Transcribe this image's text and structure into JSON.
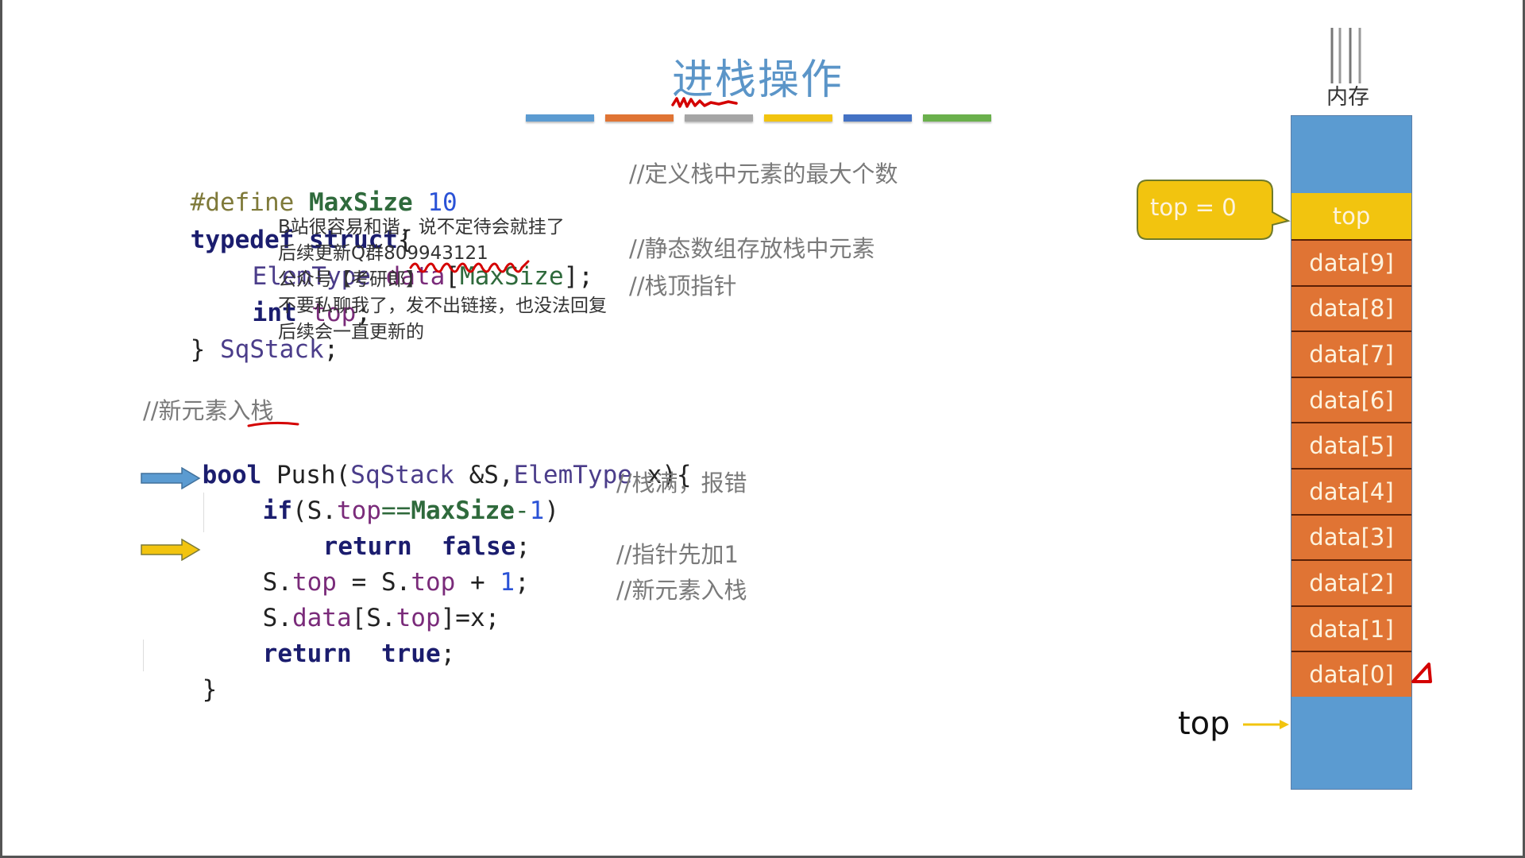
{
  "slide": {
    "title": "进栈操作",
    "title_color": "#5b95c8",
    "color_bars": [
      "#5b9bd1",
      "#e07434",
      "#a5a5a5",
      "#f2c40f",
      "#4472c4",
      "#6ab04c"
    ]
  },
  "struct_code": {
    "define": {
      "directive": "#define",
      "name": "MaxSize",
      "value": "10",
      "comment": "//定义栈中元素的最大个数"
    },
    "typedef": {
      "kw1": "typedef",
      "kw2": "struct",
      "brace": "{"
    },
    "field_data": {
      "type": "ElemType",
      "name": "data",
      "open": "[",
      "size": "MaxSize",
      "close": "];",
      "comment": "//静态数组存放栈中元素"
    },
    "field_top": {
      "type": "int",
      "name": "top",
      "semi": ";",
      "comment": "//栈顶指针"
    },
    "close": {
      "brace": "}",
      "name": "SqStack",
      "semi": ";"
    }
  },
  "push_code": {
    "header_comment": "//新元素入栈",
    "signature": {
      "ret": "bool",
      "name": " Push(",
      "p1type": "SqStack",
      "p1": " &S,",
      "p2type": "ElemType",
      "p2": " x){"
    },
    "line_if": {
      "kw": "if",
      "a": "(S.",
      "fld": "top",
      "op": "==",
      "mac": "MaxSize",
      "minus": "-",
      "num": "1",
      "close": ")",
      "comment": "//栈满，报错"
    },
    "line_return_false": {
      "kw": "return",
      "val": "false",
      "semi": ";"
    },
    "line_inc": {
      "a": "S.",
      "fld": "top",
      "b": " = S.",
      "fld2": "top",
      "c": " + ",
      "num": "1",
      "semi": ";",
      "comment": "//指针先加1"
    },
    "line_assign": {
      "a": "S.",
      "fld": "data",
      "b": "[S.",
      "fld2": "top",
      "c": "]=x;",
      "comment": "//新元素入栈"
    },
    "line_return_true": {
      "kw": "return",
      "val": "true",
      "semi": ";"
    },
    "close": "}"
  },
  "overlay_notice": [
    "B站很容易和谐，说不定待会就挂了",
    "后续更新Q群809943121",
    "公众号【考研郎】",
    "不要私聊我了，发不出链接，也没法回复",
    "后续会一直更新的"
  ],
  "memory": {
    "label": "内存",
    "top_cell": "top",
    "cells": [
      "data[9]",
      "data[8]",
      "data[7]",
      "data[6]",
      "data[5]",
      "data[4]",
      "data[3]",
      "data[2]",
      "data[1]",
      "data[0]"
    ],
    "callout": "top = 0",
    "pointer_label": "top",
    "colors": {
      "free": "#5b9bd1",
      "top": "#f2c40f",
      "data": "#e07434"
    }
  }
}
